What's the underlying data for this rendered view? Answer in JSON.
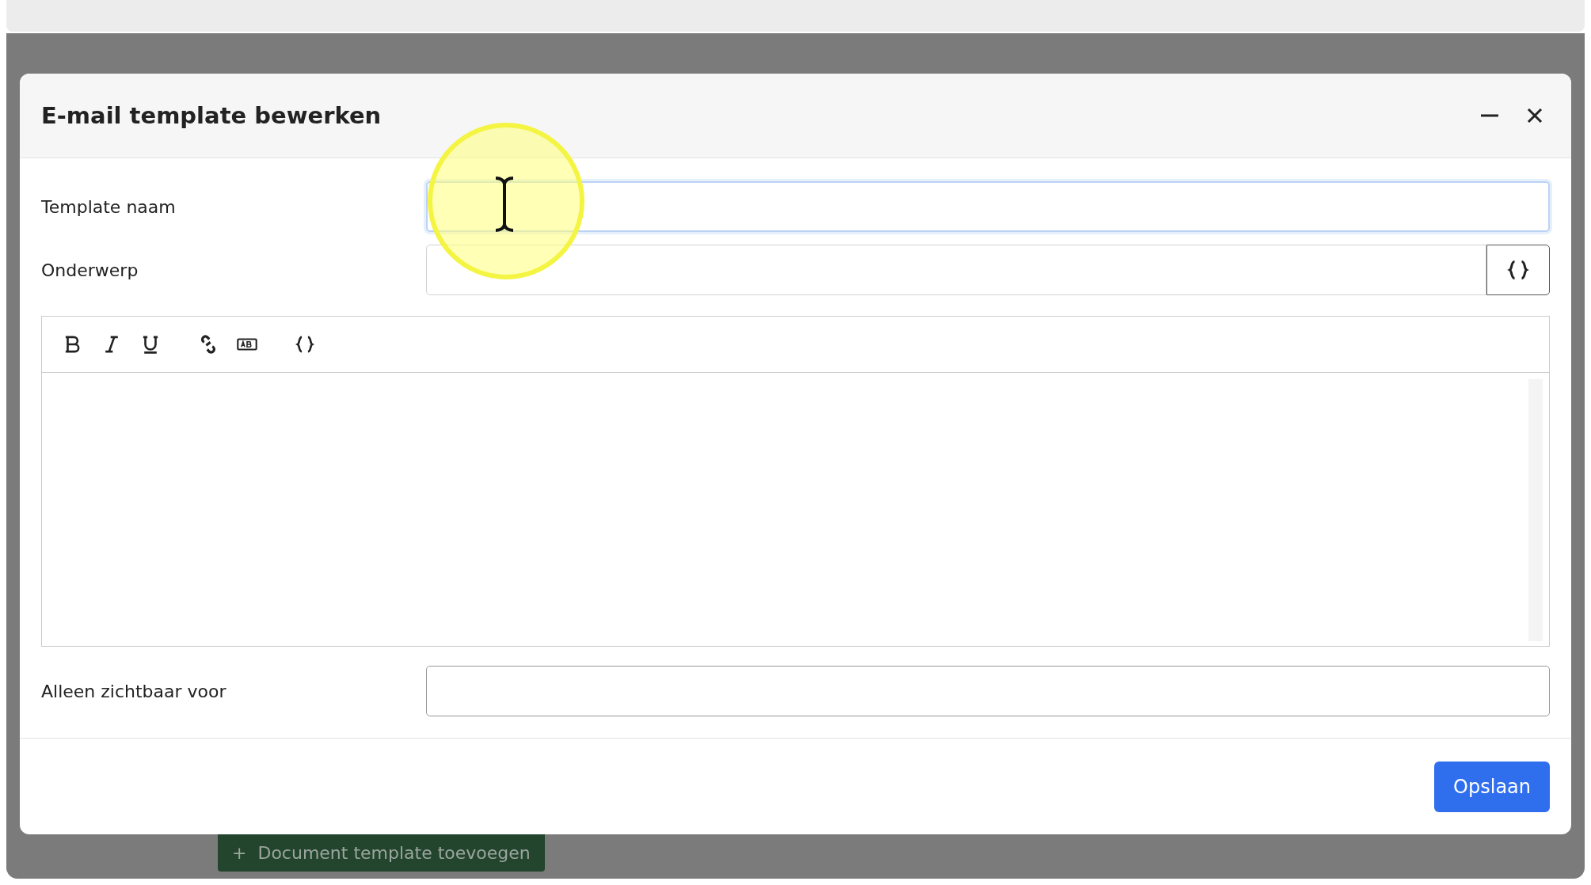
{
  "dialog": {
    "title": "E-mail template bewerken",
    "fields": [
      {
        "label": "Template naam",
        "kind": "text",
        "focused": true
      },
      {
        "label": "Onderwerp",
        "kind": "variables",
        "focused": false
      }
    ],
    "toolbar": [
      {
        "kind": "bold"
      },
      {
        "kind": "italic"
      },
      {
        "kind": "underline"
      },
      {
        "kind": "link"
      },
      {
        "kind": "field"
      },
      {
        "kind": "variables"
      }
    ],
    "visibility": {
      "label": "Alleen zichtbaar voor"
    },
    "save_button": "Opslaan"
  },
  "background": {
    "add_button": {
      "icon": "+",
      "label": "Document template toevoegen"
    }
  }
}
